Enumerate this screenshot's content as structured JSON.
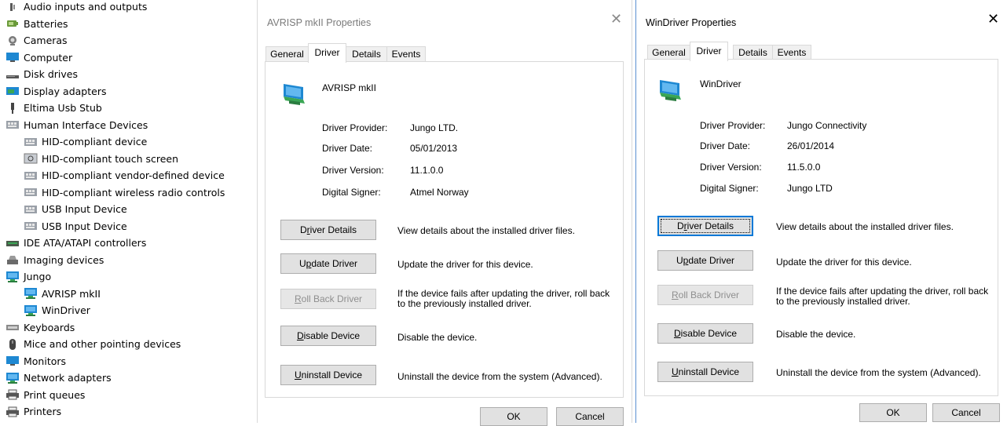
{
  "device_manager": {
    "items": [
      {
        "label": "Audio inputs and outputs",
        "level": 0,
        "icon": "speaker-icon"
      },
      {
        "label": "Batteries",
        "level": 0,
        "icon": "battery-icon"
      },
      {
        "label": "Cameras",
        "level": 0,
        "icon": "camera-icon"
      },
      {
        "label": "Computer",
        "level": 0,
        "icon": "monitor-icon"
      },
      {
        "label": "Disk drives",
        "level": 0,
        "icon": "disk-drive-icon"
      },
      {
        "label": "Display adapters",
        "level": 0,
        "icon": "display-adapter-icon"
      },
      {
        "label": "Eltima Usb Stub",
        "level": 0,
        "icon": "usb-plug-icon"
      },
      {
        "label": "Human Interface Devices",
        "level": 0,
        "icon": "hid-icon"
      },
      {
        "label": "HID-compliant device",
        "level": 1,
        "icon": "hid-icon"
      },
      {
        "label": "HID-compliant touch screen",
        "level": 1,
        "icon": "touch-screen-icon"
      },
      {
        "label": "HID-compliant vendor-defined device",
        "level": 1,
        "icon": "hid-icon"
      },
      {
        "label": "HID-compliant wireless radio controls",
        "level": 1,
        "icon": "hid-icon"
      },
      {
        "label": "USB Input Device",
        "level": 1,
        "icon": "hid-icon"
      },
      {
        "label": "USB Input Device",
        "level": 1,
        "icon": "hid-icon"
      },
      {
        "label": "IDE ATA/ATAPI controllers",
        "level": 0,
        "icon": "ide-controller-icon"
      },
      {
        "label": "Imaging devices",
        "level": 0,
        "icon": "imaging-device-icon"
      },
      {
        "label": "Jungo",
        "level": 0,
        "icon": "network-device-icon"
      },
      {
        "label": "AVRISP mkII",
        "level": 1,
        "icon": "network-device-icon"
      },
      {
        "label": "WinDriver",
        "level": 1,
        "icon": "network-device-icon"
      },
      {
        "label": "Keyboards",
        "level": 0,
        "icon": "keyboard-icon"
      },
      {
        "label": "Mice and other pointing devices",
        "level": 0,
        "icon": "mouse-icon"
      },
      {
        "label": "Monitors",
        "level": 0,
        "icon": "monitor-icon"
      },
      {
        "label": "Network adapters",
        "level": 0,
        "icon": "network-device-icon"
      },
      {
        "label": "Print queues",
        "level": 0,
        "icon": "printer-icon"
      },
      {
        "label": "Printers",
        "level": 0,
        "icon": "printer-icon"
      }
    ]
  },
  "dialogs": [
    {
      "title": "AVRISP mkII Properties",
      "tabs": [
        "General",
        "Driver",
        "Details",
        "Events"
      ],
      "active_tab": "Driver",
      "device_name": "AVRISP mkII",
      "info": [
        {
          "label": "Driver Provider:",
          "value": "Jungo LTD."
        },
        {
          "label": "Driver Date:",
          "value": "05/01/2013"
        },
        {
          "label": "Driver Version:",
          "value": "11.1.0.0"
        },
        {
          "label": "Digital Signer:",
          "value": "Atmel Norway"
        }
      ],
      "buttons": [
        {
          "label": "Driver Details",
          "mnemonic": "r",
          "desc": "View details about the installed driver files.",
          "enabled": true
        },
        {
          "label": "Update Driver",
          "mnemonic": "p",
          "desc": "Update the driver for this device.",
          "enabled": true
        },
        {
          "label": "Roll Back Driver",
          "mnemonic": "R",
          "desc": "If the device fails after updating the driver, roll back to the previously installed driver.",
          "enabled": false
        },
        {
          "label": "Disable Device",
          "mnemonic": "D",
          "desc": "Disable the device.",
          "enabled": true
        },
        {
          "label": "Uninstall Device",
          "mnemonic": "U",
          "desc": "Uninstall the device from the system (Advanced).",
          "enabled": true
        }
      ],
      "ok_label": "OK",
      "cancel_label": "Cancel"
    },
    {
      "title": "WinDriver Properties",
      "tabs": [
        "General",
        "Driver",
        "Details",
        "Events"
      ],
      "active_tab": "Driver",
      "device_name": "WinDriver",
      "info": [
        {
          "label": "Driver Provider:",
          "value": "Jungo Connectivity"
        },
        {
          "label": "Driver Date:",
          "value": "26/01/2014"
        },
        {
          "label": "Driver Version:",
          "value": "11.5.0.0"
        },
        {
          "label": "Digital Signer:",
          "value": "Jungo LTD"
        }
      ],
      "buttons": [
        {
          "label": "Driver Details",
          "mnemonic": "r",
          "desc": "View details about the installed driver files.",
          "enabled": true,
          "focused": true
        },
        {
          "label": "Update Driver",
          "mnemonic": "p",
          "desc": "Update the driver for this device.",
          "enabled": true
        },
        {
          "label": "Roll Back Driver",
          "mnemonic": "R",
          "desc": "If the device fails after updating the driver, roll back to the previously installed driver.",
          "enabled": false
        },
        {
          "label": "Disable Device",
          "mnemonic": "D",
          "desc": "Disable the device.",
          "enabled": true
        },
        {
          "label": "Uninstall Device",
          "mnemonic": "U",
          "desc": "Uninstall the device from the system (Advanced).",
          "enabled": true
        }
      ],
      "ok_label": "OK",
      "cancel_label": "Cancel"
    }
  ],
  "colors": {
    "focus_blue": "#0078d7",
    "button_face": "#e1e1e1",
    "disabled_text": "#8f8f8f",
    "device_icon_blue": "#1e88d2",
    "device_icon_green": "#3aa655"
  }
}
